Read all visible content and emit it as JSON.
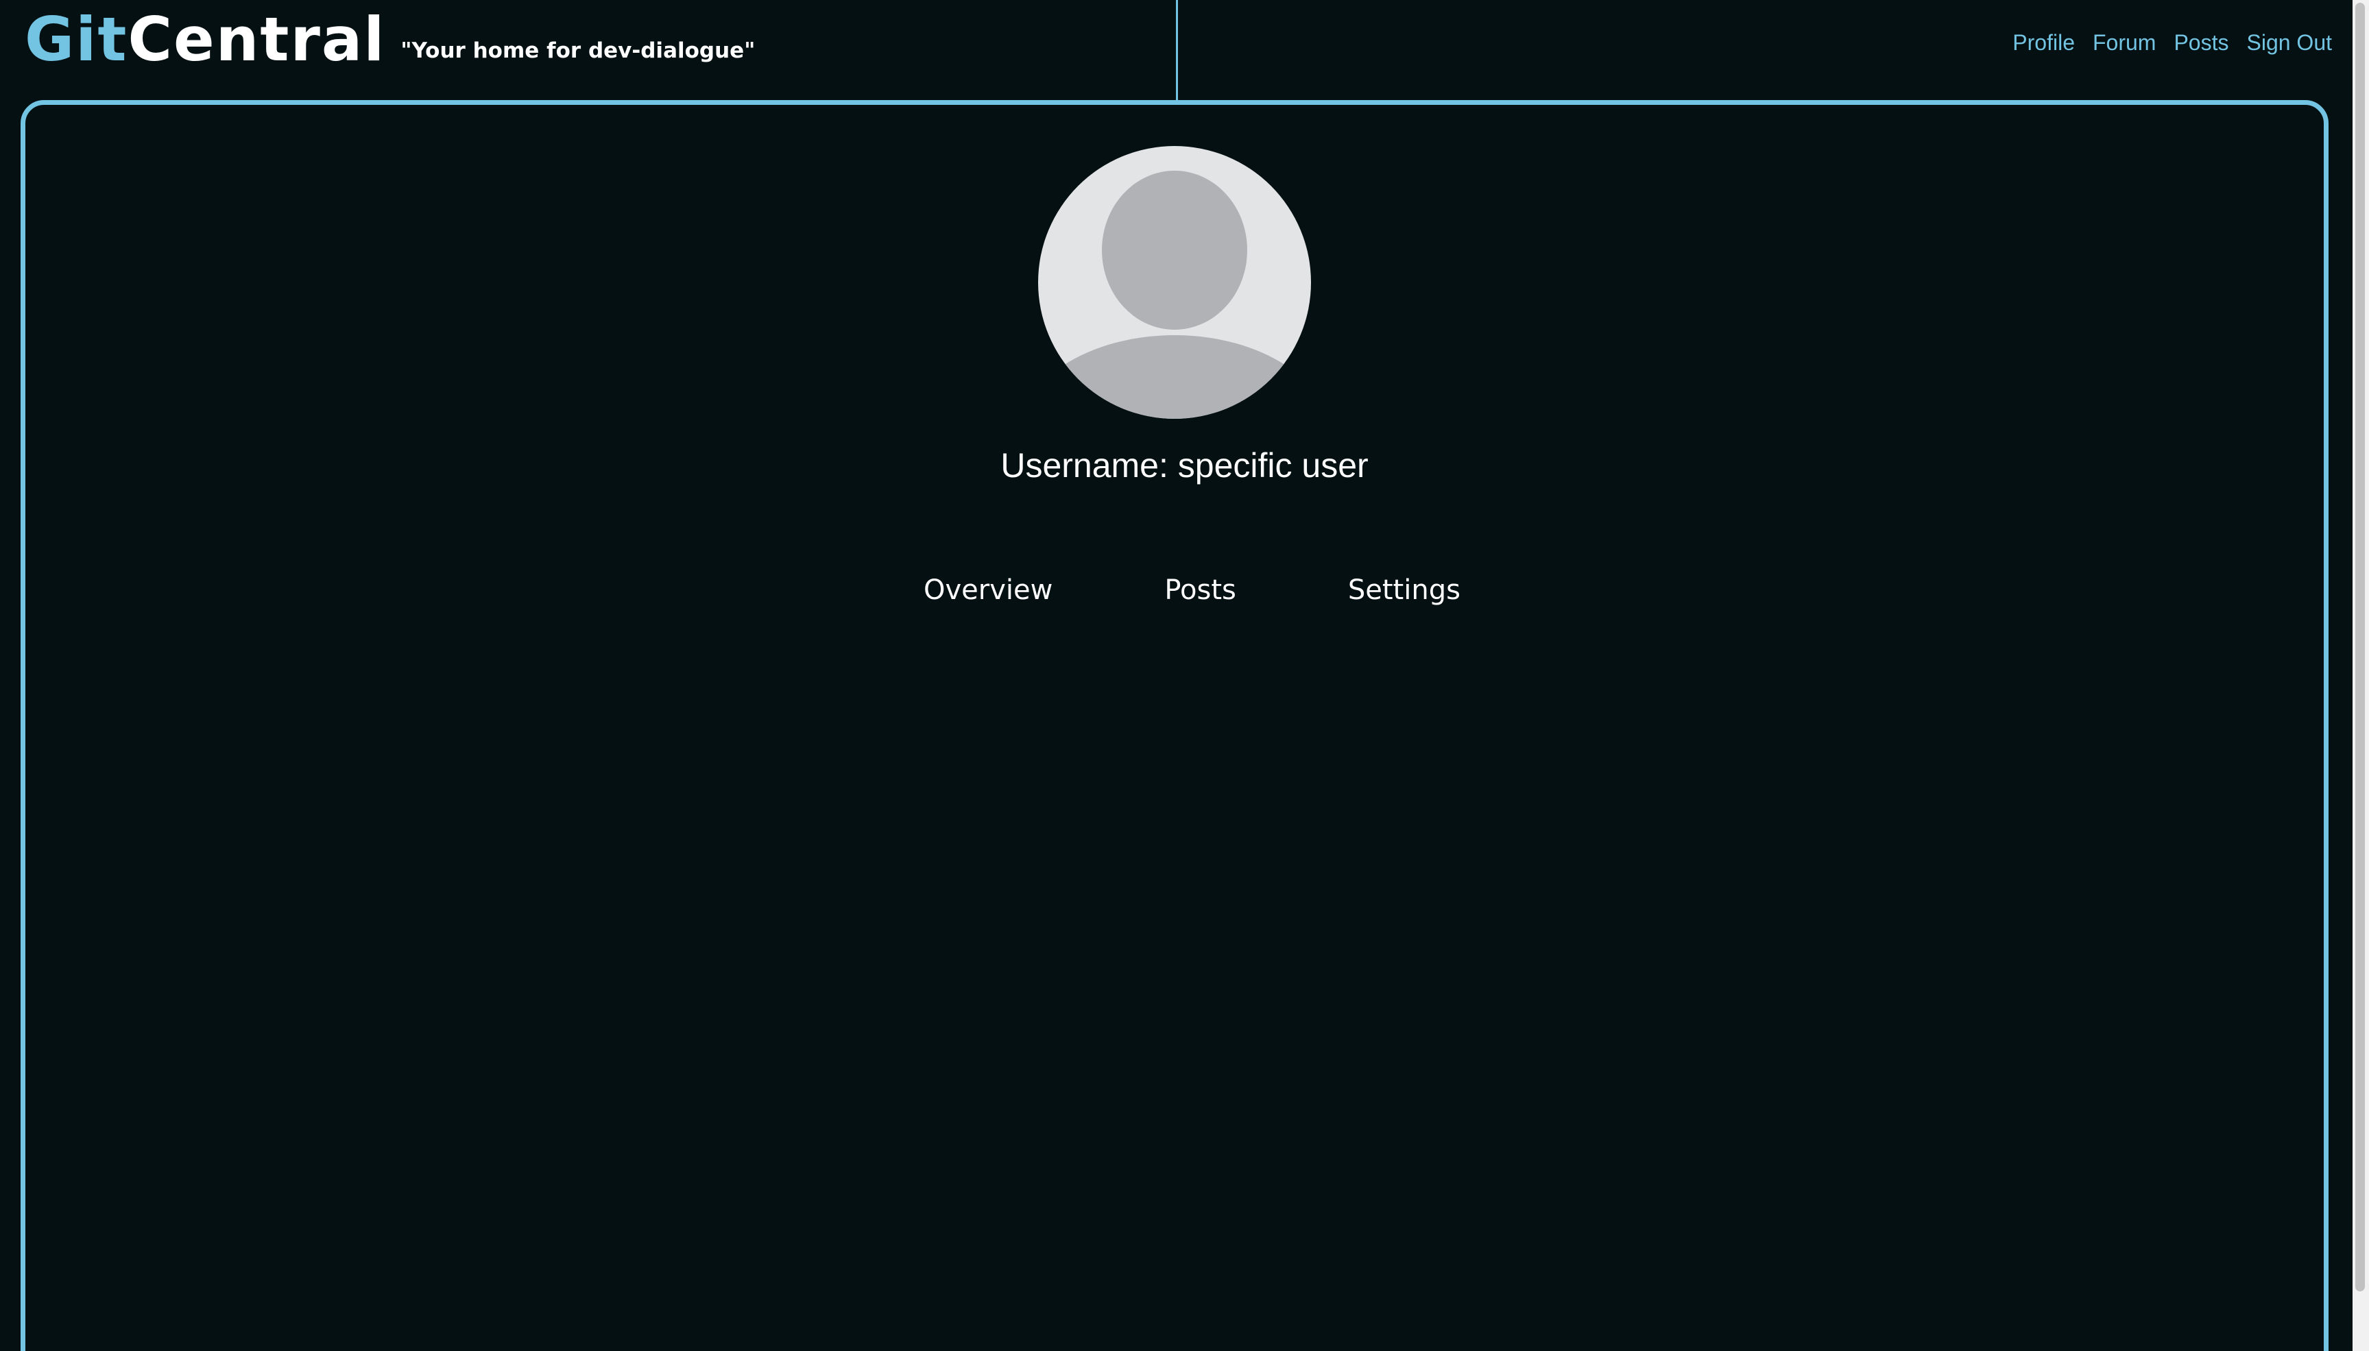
{
  "brand": {
    "logo_part1": "Git",
    "logo_part2": "Central",
    "tagline": "\"Your home for dev-dialogue\""
  },
  "nav": {
    "items": [
      {
        "label": "Profile"
      },
      {
        "label": "Forum"
      },
      {
        "label": "Posts"
      },
      {
        "label": "Sign Out"
      }
    ]
  },
  "profile": {
    "avatar_icon": "default-user-avatar-icon",
    "username_text": "Username: specific user",
    "tabs": [
      {
        "label": "Overview"
      },
      {
        "label": "Posts"
      },
      {
        "label": "Settings"
      }
    ]
  },
  "colors": {
    "background": "#051013",
    "accent": "#72c4e2",
    "text": "#ffffff"
  }
}
